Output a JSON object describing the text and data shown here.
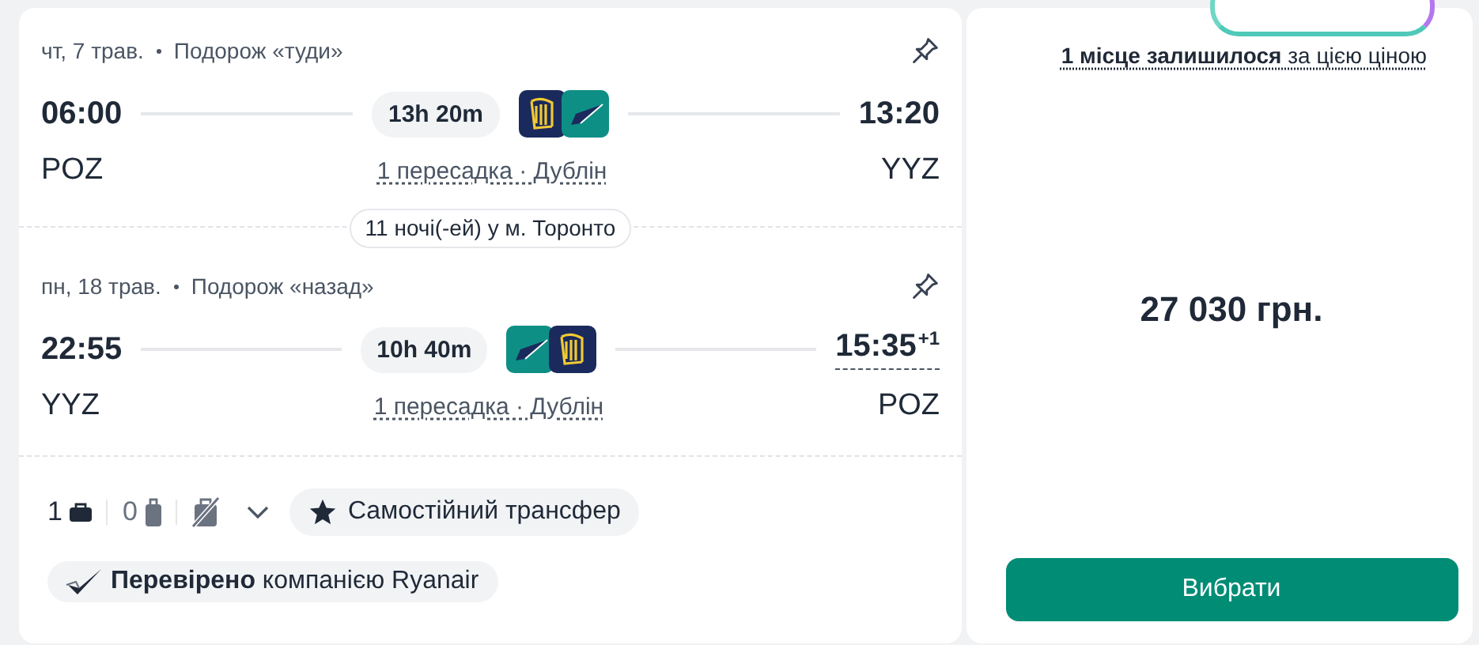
{
  "legs": [
    {
      "date": "чт, 7 трав.",
      "trip": "Подорож «туди»",
      "dep_time": "06:00",
      "arr_time": "13:20",
      "duration": "13h 20m",
      "from": "POZ",
      "to": "YYZ",
      "stops": "1 пересадка · Дублін",
      "airlines": [
        {
          "kind": "harp"
        },
        {
          "kind": "wing"
        }
      ]
    },
    {
      "date": "пн, 18 трав.",
      "trip": "Подорож «назад»",
      "dep_time": "22:55",
      "arr_time": "15:35",
      "arr_offset": "+1",
      "duration": "10h 40m",
      "from": "YYZ",
      "to": "POZ",
      "stops": "1 пересадка · Дублін",
      "airlines": [
        {
          "kind": "wing"
        },
        {
          "kind": "harp"
        }
      ]
    }
  ],
  "layover": "11 ночі(-ей) у м. Торонто",
  "baggage": [
    {
      "kind": "personal",
      "count": "1"
    },
    {
      "kind": "cabin",
      "count": "0"
    },
    {
      "kind": "checked_none"
    }
  ],
  "transfer": "Самостійний трансфер",
  "verified": "**Перевірено** компанією Ryanair",
  "seats_left": "**1 місце залишилося** за цією ціною",
  "price": "27 030 грн.",
  "select_button": "Вибрати"
}
